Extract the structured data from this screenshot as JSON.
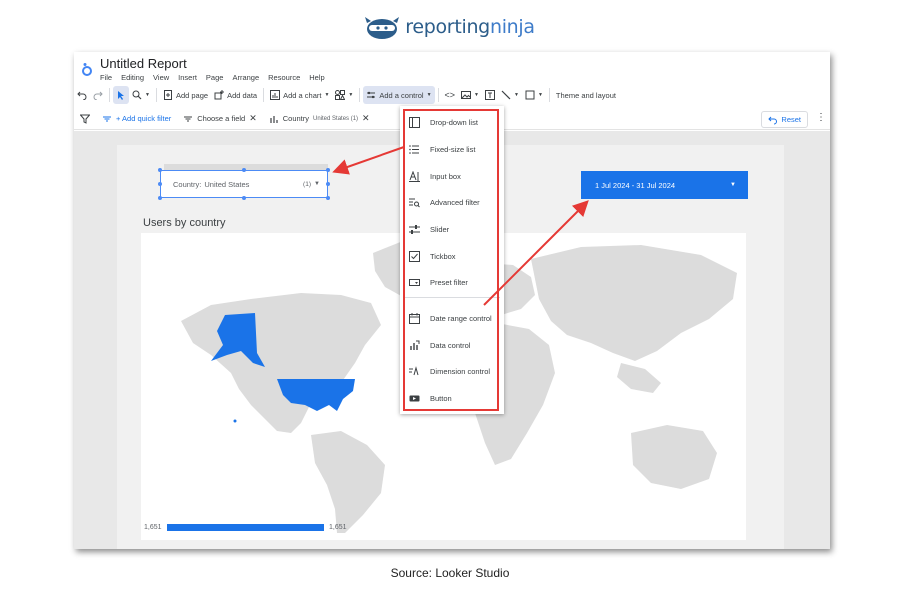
{
  "brand": {
    "name_main": "reporting",
    "name_accent": "ninja"
  },
  "app": {
    "title": "Untitled Report",
    "menu": [
      "File",
      "Editing",
      "View",
      "Insert",
      "Page",
      "Arrange",
      "Resource",
      "Help"
    ]
  },
  "toolbar": {
    "add_page": "Add page",
    "add_data": "Add data",
    "add_chart": "Add a chart",
    "add_control": "Add a control",
    "theme_layout": "Theme and layout"
  },
  "filterbar": {
    "add_quick_filter": "+ Add quick filter",
    "choose_field": "Choose a field",
    "country_chip": "Country",
    "country_chip_detail": "United States (1)",
    "reset": "Reset"
  },
  "country_control": {
    "label": "Country:",
    "value": "United States",
    "count": "(1)"
  },
  "date_control": {
    "value": "1 Jul 2024 - 31 Jul 2024"
  },
  "chart": {
    "title": "Users by country",
    "legend_min": "1,651",
    "legend_max": "1,651"
  },
  "dropdown": {
    "items": [
      {
        "label": "Drop-down list",
        "icon": "dropdown-list-icon"
      },
      {
        "label": "Fixed-size list",
        "icon": "list-icon"
      },
      {
        "label": "Input box",
        "icon": "input-box-icon"
      },
      {
        "label": "Advanced filter",
        "icon": "advanced-filter-icon"
      },
      {
        "label": "Slider",
        "icon": "slider-icon"
      },
      {
        "label": "Tickbox",
        "icon": "checkbox-icon"
      },
      {
        "label": "Preset filter",
        "icon": "preset-filter-icon"
      },
      {
        "label": "Date range control",
        "icon": "calendar-icon"
      },
      {
        "label": "Data control",
        "icon": "data-control-icon"
      },
      {
        "label": "Dimension control",
        "icon": "dimension-control-icon"
      },
      {
        "label": "Button",
        "icon": "button-icon"
      }
    ]
  },
  "caption": "Source: Looker Studio",
  "colors": {
    "accent": "#1a73e8",
    "highlight": "#e53935",
    "map_fill": "#1a73e8"
  }
}
